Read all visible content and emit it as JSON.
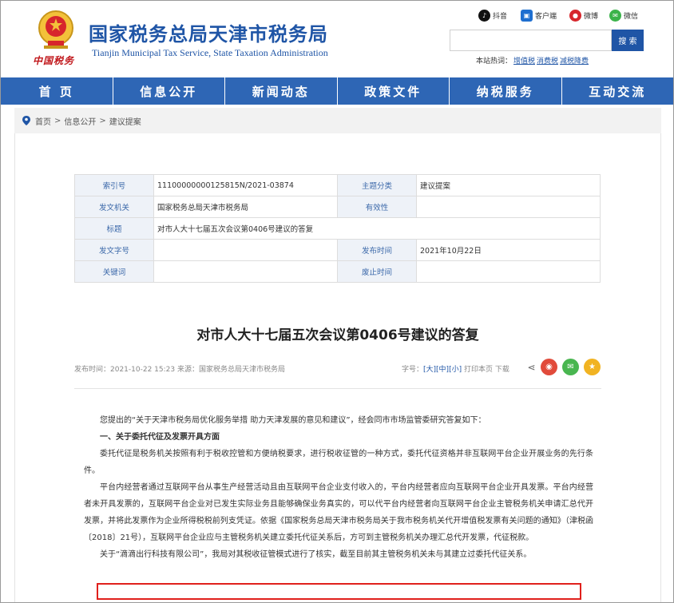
{
  "header": {
    "title": "国家税务总局天津市税务局",
    "subtitle": "Tianjin Municipal Tax Service, State Taxation Administration",
    "brand_sign": "中国税务",
    "social": [
      {
        "label": "抖音",
        "icon": "douyin-icon"
      },
      {
        "label": "客户端",
        "icon": "app-client-icon"
      },
      {
        "label": "微博",
        "icon": "weibo-icon"
      },
      {
        "label": "微信",
        "icon": "wechat-icon"
      }
    ],
    "search_button": "搜 索",
    "search_placeholder": "",
    "hot_label": "本站热词：",
    "hot_words": [
      "增值税",
      "消费税",
      "减税降费"
    ]
  },
  "nav": [
    "首 页",
    "信息公开",
    "新闻动态",
    "政策文件",
    "纳税服务",
    "互动交流"
  ],
  "breadcrumb": [
    "首页",
    "信息公开",
    "建议提案"
  ],
  "meta": {
    "index_label": "索引号",
    "index_value": "11100000000125815N/2021-03874",
    "topic_label": "主题分类",
    "topic_value": "建议提案",
    "issuer_label": "发文机关",
    "issuer_value": "国家税务总局天津市税务局",
    "validity_label": "有效性",
    "validity_value": "",
    "title_label": "标题",
    "title_value": "对市人大十七届五次会议第0406号建议的答复",
    "docno_label": "发文字号",
    "docno_value": "",
    "pubdate_label": "发布时间",
    "pubdate_value": "2021年10月22日",
    "keywords_label": "关键词",
    "keywords_value": "",
    "abolish_label": "废止时间",
    "abolish_value": ""
  },
  "article": {
    "title": "对市人大十七届五次会议第0406号建议的答复",
    "pubinfo": "发布时间：2021-10-22 15:23  来源：国家税务总局天津市税务局",
    "font_label": "字号：",
    "size_large": "[大]",
    "size_medium": "[中]",
    "size_small": "[小]",
    "print": "打印本页",
    "download": "下载",
    "paragraphs": [
      "您提出的“关于天津市税务局优化服务举措 助力天津发展的意见和建议”，经会同市市场监管委研究答复如下：",
      "一、关于委托代征及发票开具方面",
      "委托代征是税务机关按照有利于税收控管和方便纳税要求，进行税收征管的一种方式，委托代征资格并非互联网平台企业开展业务的先行条件。",
      "平台内经营者通过互联网平台从事生产经营活动且由互联网平台企业支付收入的，平台内经营者应向互联网平台企业开具发票。平台内经营者未开具发票的，互联网平台企业对已发生实际业务且能够确保业务真实的，可以代平台内经营者向互联网平台企业主管税务机关申请汇总代开发票，并将此发票作为企业所得税税前列支凭证。依据《国家税务总局天津市税务局关于我市税务机关代开增值税发票有关问题的通知》（津税函〔2018〕21号），互联网平台企业应与主管税务机关建立委托代征关系后，方可到主管税务机关办理汇总代开发票，代征税款。",
      "关于“滴滴出行科技有限公司”，我局对其税收征管模式进行了核实，截至目前其主管税务机关未与其建立过委托代征关系。"
    ]
  },
  "colors": {
    "brand_blue": "#1f55a6",
    "nav_blue": "#2e66b5",
    "highlight_red": "#e0201c"
  }
}
